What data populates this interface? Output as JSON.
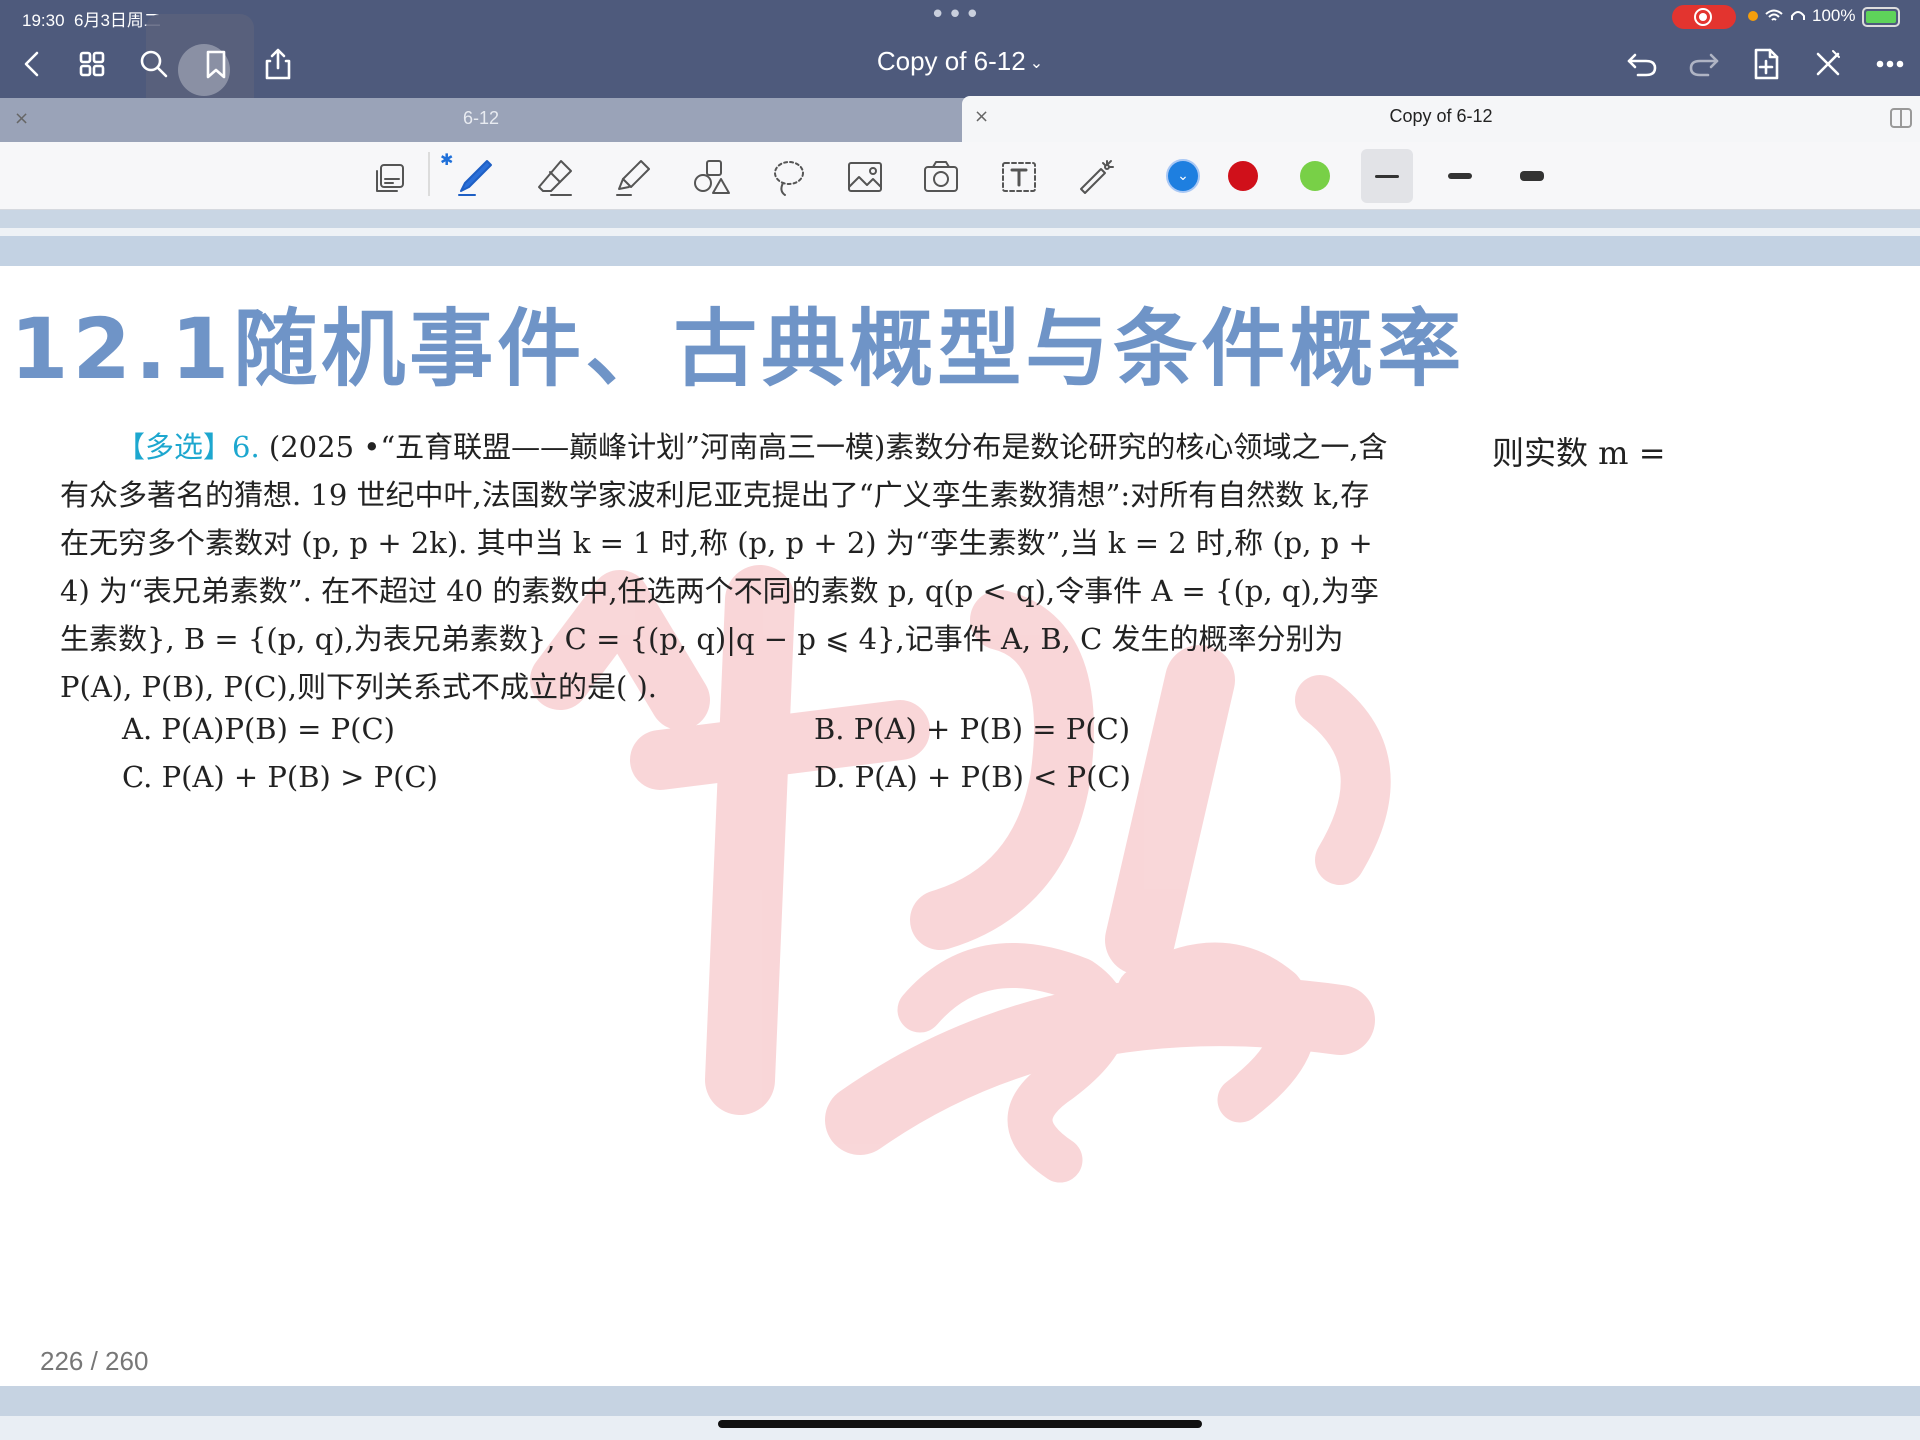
{
  "status_bar": {
    "time": "19:30",
    "date": "6月3日周二",
    "dots": "•••",
    "battery_text": "100%"
  },
  "nav": {
    "title": "Copy of 6-12",
    "title_chevron": "⌄",
    "icons_left": [
      "back-icon",
      "grid-icon",
      "search-icon",
      "bookmark-icon",
      "share-icon"
    ],
    "icons_right": [
      "undo-icon",
      "redo-icon",
      "add-page-icon",
      "close-icon",
      "more-icon"
    ]
  },
  "tabs": [
    {
      "label": "6-12",
      "close": "×",
      "active": false
    },
    {
      "label": "Copy of 6-12",
      "close": "×",
      "active": true
    }
  ],
  "toolbar": {
    "tools": [
      "read-mode-icon",
      "pen-icon",
      "eraser-icon",
      "highlighter-icon",
      "shapes-icon",
      "lasso-icon",
      "image-icon",
      "camera-icon",
      "text-icon",
      "laser-pointer-icon"
    ],
    "bluetooth": "✱",
    "colors": {
      "selected": "#1e7fe0",
      "red": "#d0101a",
      "green": "#78d047"
    },
    "stroke_widths": [
      "thin",
      "medium",
      "thick"
    ]
  },
  "content": {
    "section_title": "12.1随机事件、古典概型与条件概率",
    "question": {
      "tag": "【多选】",
      "number": "6.",
      "line1": "(2025 •“五育联盟——巅峰计划”河南高三一模)素数分布是数论研究的核心领域之一,含",
      "line2": "有众多著名的猜想. 19 世纪中叶,法国数学家波利尼亚克提出了“广义孪生素数猜想”:对所有自然数 k,存",
      "line3": "在无穷多个素数对 (p, p + 2k). 其中当 k = 1 时,称 (p, p + 2) 为“孪生素数”,当 k = 2 时,称 (p, p +",
      "line4": "4) 为“表兄弟素数”. 在不超过 40 的素数中,任选两个不同的素数 p, q(p < q),令事件 A = {(p, q),为孪",
      "line5": "生素数}, B = {(p, q),为表兄弟素数}, C = {(p, q)|q − p ⩽ 4},记事件 A, B, C 发生的概率分别为",
      "line6": "P(A), P(B), P(C),则下列关系式不成立的是(        ).",
      "options": {
        "A": "A. P(A)P(B) = P(C)",
        "B": "B. P(A) + P(B) = P(C)",
        "C": "C. P(A) + P(B) > P(C)",
        "D": "D. P(A) + P(B) < P(C)"
      }
    },
    "side_note": "则实数 m ="
  },
  "footer": {
    "page_indicator": "226 / 260"
  }
}
